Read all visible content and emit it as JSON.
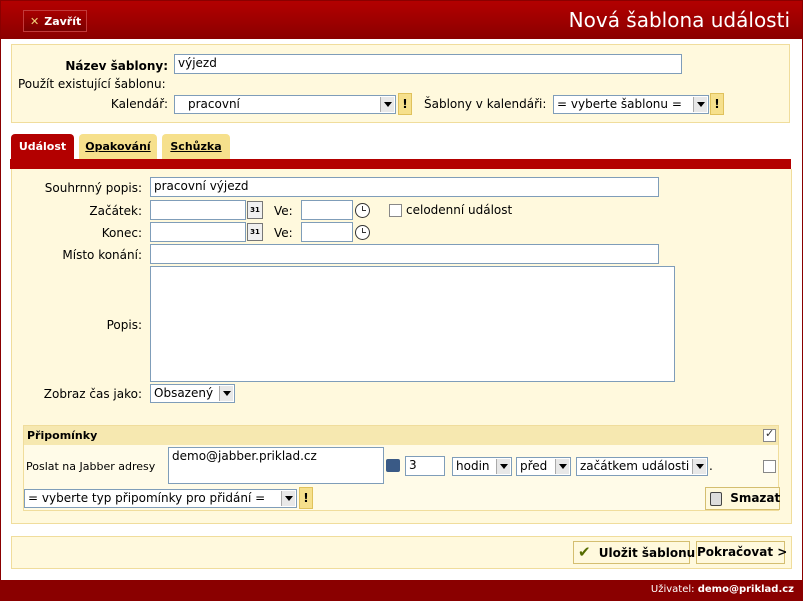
{
  "header": {
    "close_label": "Zavřít",
    "close_icon": "close-icon",
    "title": "Nová šablona události"
  },
  "template": {
    "name_label": "Název šablony:",
    "name_value": "výjezd",
    "use_existing_label": "Použít existující šablonu:",
    "calendar_label": "Kalendář:",
    "calendar_value": "pracovní",
    "calendar_templates_label": "Šablony v kalendáři:",
    "calendar_templates_value": "= vyberte šablonu =",
    "excl": "!"
  },
  "tabs": [
    {
      "label": "Událost",
      "active": true
    },
    {
      "label": "Opakování",
      "active": false
    },
    {
      "label": "Schůzka",
      "active": false
    }
  ],
  "event": {
    "summary_label": "Souhrnný popis:",
    "summary_value": "pracovní výjezd",
    "start_label": "Začátek:",
    "end_label": "Konec:",
    "at_label": "Ve:",
    "calendar_icon_text": "31",
    "allday_label": "celodenní událost",
    "location_label": "Místo konání:",
    "description_label": "Popis:",
    "show_time_label": "Zobraz čas jako:",
    "show_time_value": "Obsazený"
  },
  "reminders": {
    "title": "Připomínky",
    "row_label": "Poslat na Jabber adresy",
    "jabber_value": "demo@jabber.priklad.cz",
    "amount": "3",
    "unit": "hodin",
    "relation": "před",
    "anchor": "začátkem události",
    "dot": ".",
    "add_type_value": "= vyberte typ připomínky pro přidání =",
    "delete_label": "Smazat"
  },
  "actions": {
    "save_label": "Uložit šablonu",
    "continue_label": "Pokračovat >"
  },
  "footer": {
    "user_label": "Uživatel:",
    "user_value": "demo@priklad.cz"
  },
  "colors": {
    "brand": "#8a0000",
    "panel_bg": "#fff9dd",
    "tab_inactive": "#f6e08c"
  }
}
